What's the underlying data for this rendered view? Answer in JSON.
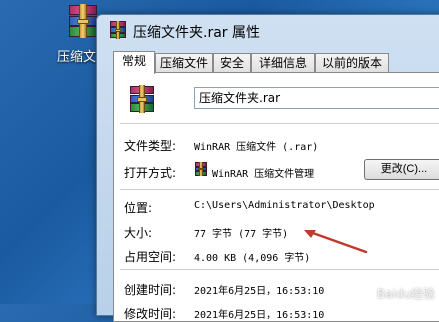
{
  "desktop": {
    "icon_label": "压缩文件"
  },
  "window": {
    "title": "压缩文件夹.rar 属性"
  },
  "tabs": [
    {
      "label": "常规",
      "active": true
    },
    {
      "label": "压缩文件"
    },
    {
      "label": "安全"
    },
    {
      "label": "详细信息"
    },
    {
      "label": "以前的版本"
    }
  ],
  "general": {
    "filename": "压缩文件夹.rar",
    "type_label": "文件类型:",
    "type_value": "WinRAR 压缩文件 (.rar)",
    "open_label": "打开方式:",
    "open_value": "WinRAR 压缩文件管理",
    "change_button": "更改(C)...",
    "location_label": "位置:",
    "location_value": "C:\\Users\\Administrator\\Desktop",
    "size_label": "大小:",
    "size_value": "77 字节 (77 字节)",
    "disk_label": "占用空间:",
    "disk_value": "4.00 KB (4,096 字节)",
    "created_label": "创建时间:",
    "created_value": "2021年6月25日，16:53:10",
    "modified_label": "修改时间:",
    "modified_value": "2021年6月25日，16:53:10"
  },
  "colors": {
    "arrow": "#c0392b",
    "desktop": "#2a6bb0"
  },
  "watermark": "Baidu经验"
}
